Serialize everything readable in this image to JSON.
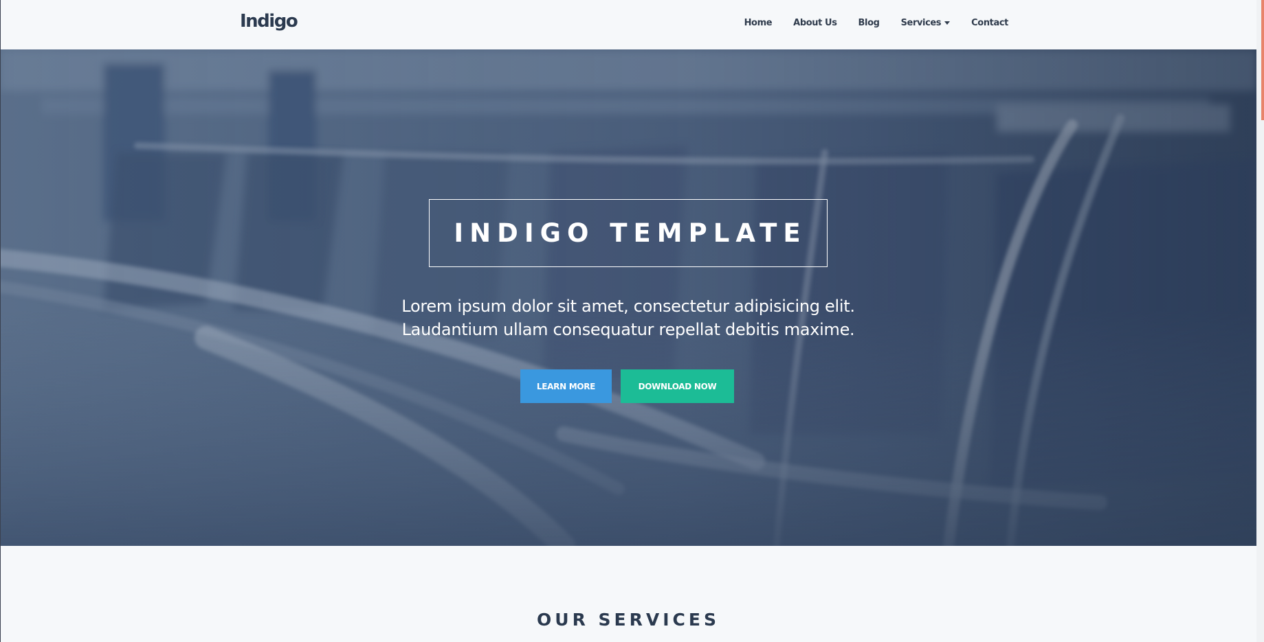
{
  "navbar": {
    "brand": "Indigo",
    "items": [
      {
        "label": "Home"
      },
      {
        "label": "About Us"
      },
      {
        "label": "Blog"
      },
      {
        "label": "Services",
        "has_dropdown": true
      },
      {
        "label": "Contact"
      }
    ]
  },
  "hero": {
    "title": "INDIGO TEMPLATE",
    "text_line1": "Lorem ipsum dolor sit amet, consectetur adipisicing elit.",
    "text_line2": "Laudantium ullam consequatur repellat debitis maxime.",
    "buttons": {
      "learn_more": "LEARN MORE",
      "download_now": "DOWNLOAD NOW"
    }
  },
  "services": {
    "title": "OUR SERVICES"
  },
  "colors": {
    "brand_text": "#2b3a4f",
    "learn_more_bg": "#3a98df",
    "download_bg": "#1cbc96",
    "scroll_thumb": "#e8836a"
  }
}
